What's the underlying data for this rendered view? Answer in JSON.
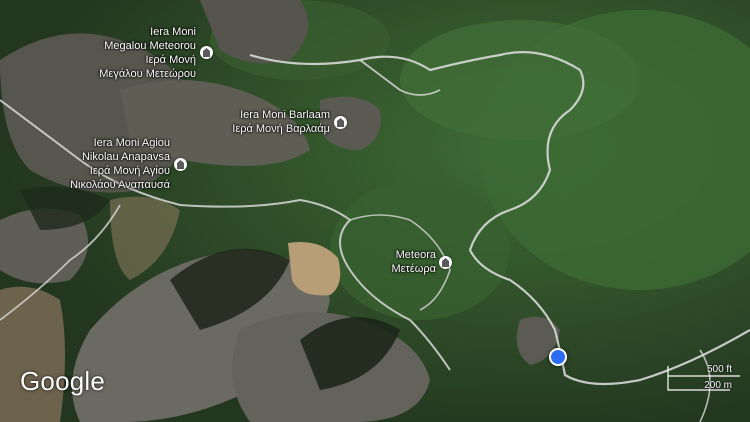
{
  "map": {
    "places": [
      {
        "lines": [
          "Iera Moni",
          "Megalou Meteorou",
          "Ιερά Μονή",
          "Μεγάλου Μετεώρου"
        ]
      },
      {
        "lines": [
          "Iera Moni Barlaam",
          "Ιερά Μονή Βαρλαάμ"
        ]
      },
      {
        "lines": [
          "Iera Moni Agiou",
          "Nikolau Anapavsa",
          "Ιερά Μονή Αγίου",
          "Νικολάου Αναπαυσά"
        ]
      },
      {
        "lines": [
          "Meteora",
          "Μετέωρα"
        ]
      }
    ],
    "place_icon": "monastery-icon",
    "current_location_icon": "current-location-dot",
    "attribution": "Google",
    "scale": {
      "metric": "500 ft",
      "imperial": "200 m"
    },
    "colors": {
      "vegetation": "#2f5a2a",
      "rock": "#6b6a62",
      "road": "#d8d8d8",
      "location": "#2a6df4"
    }
  }
}
